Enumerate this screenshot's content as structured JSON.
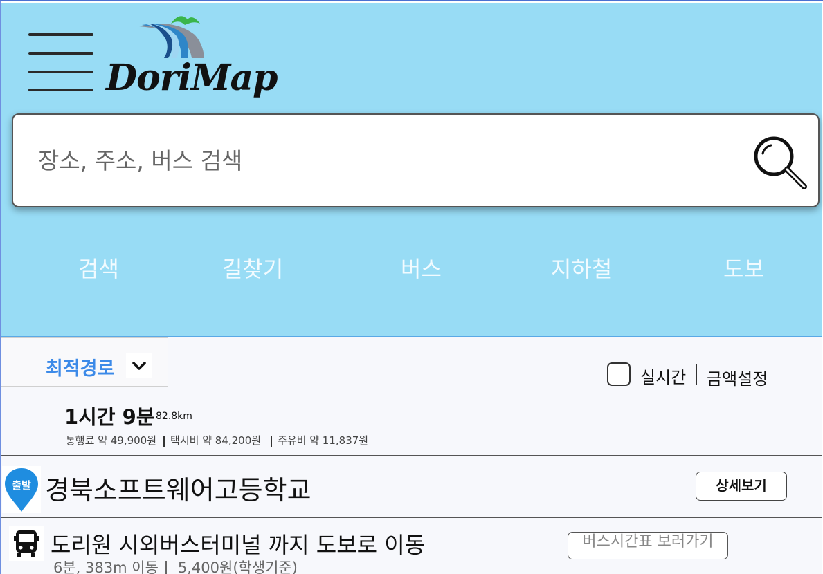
{
  "app": {
    "logo_text": "DoriMap"
  },
  "search": {
    "placeholder": "장소, 주소, 버스 검색"
  },
  "nav": {
    "items": [
      "검색",
      "길찾기",
      "버스",
      "지하철",
      "도보"
    ]
  },
  "route_options": {
    "selected": "최적경로",
    "realtime_label": "실시간",
    "realtime_checked": false,
    "amount_setting_label": "금액설정"
  },
  "summary": {
    "duration": "1시간 9분",
    "distance": "82.8km",
    "toll": "통행료 약 49,900원",
    "taxi": "택시비 약 84,200원",
    "fuel": "주유비 약 11,837원"
  },
  "start": {
    "badge": "출발",
    "name": "경북소프트웨어고등학교",
    "detail_button": "상세보기"
  },
  "step": {
    "title": "도리원 시외버스터미널 까지 도보로 이동",
    "time_distance": "6분, 383m 이동",
    "price": "5,400원(학생기준)",
    "timetable_button": "버스시간표 보러가기"
  },
  "colors": {
    "header_bg": "#98dcf5",
    "accent_blue": "#3c8ae8",
    "pin_blue": "#1f8de0"
  }
}
